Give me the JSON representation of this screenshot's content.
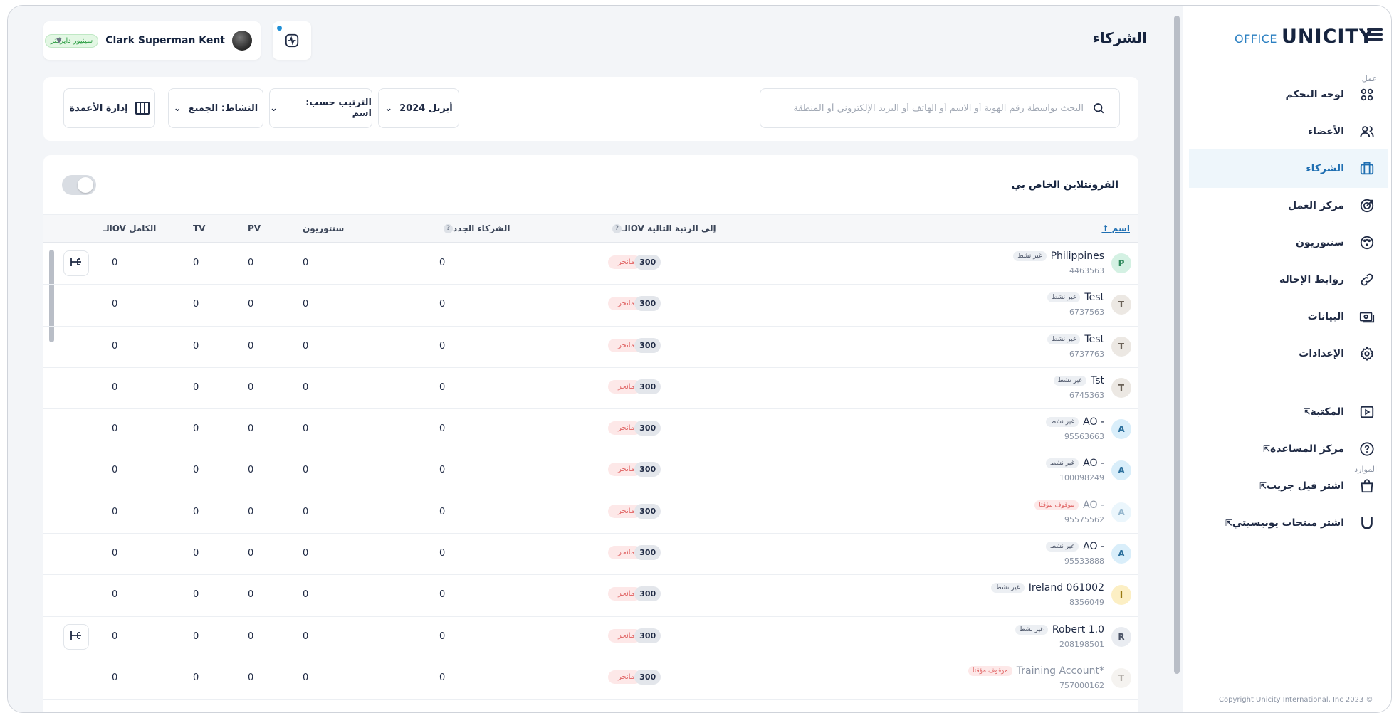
{
  "brand": {
    "office": "OFFICE",
    "unicity": "UNICITY"
  },
  "sidebar": {
    "section_work": "عمل",
    "section_resources": "الموارد",
    "items": [
      {
        "label": "لوحة التحكم",
        "icon": "dashboard-icon",
        "active": false,
        "external": false
      },
      {
        "label": "الأعضاء",
        "icon": "members-icon",
        "active": false,
        "external": false
      },
      {
        "label": "الشركاء",
        "icon": "partners-icon",
        "active": true,
        "external": false
      },
      {
        "label": "مركز العمل",
        "icon": "target-icon",
        "active": false,
        "external": false
      },
      {
        "label": "سنتوريون",
        "icon": "centurion-icon",
        "active": false,
        "external": false
      },
      {
        "label": "روابط الإحالة",
        "icon": "link-icon",
        "active": false,
        "external": false
      },
      {
        "label": "البيانات",
        "icon": "money-icon",
        "active": false,
        "external": false
      },
      {
        "label": "الإعدادات",
        "icon": "gear-icon",
        "active": false,
        "external": false
      }
    ],
    "resources": [
      {
        "label": "المكتبة",
        "icon": "play-icon",
        "external": true
      },
      {
        "label": "مركز المساعدة",
        "icon": "help-icon",
        "external": true
      },
      {
        "label": "اشتر فيل جريت",
        "icon": "bag-icon",
        "external": true
      },
      {
        "label": "اشتر منتجات يونيسيتي",
        "icon": "unicity-u-icon",
        "external": true
      }
    ],
    "external_glyph": "⇱",
    "copyright": "Copyright Unicity International, Inc 2023 ©"
  },
  "header": {
    "title": "الشركاء",
    "user": {
      "name": "Clark Superman Kent",
      "rank": "سينيور دايركتر"
    }
  },
  "filters": {
    "search_placeholder": "البحث بواسطة رقم الهوية أو الاسم أو الهاتف أو البريد الإلكتروني أو المنطقة",
    "month": "أبريل 2024",
    "sort": "الترتيب حسب: اسم",
    "activity": "النشاط: الجميع",
    "columns": "إدارة الأعمدة"
  },
  "frontline": {
    "title": "الفرونتلاين الخاص بي",
    "columns": {
      "name": "اسم",
      "ov_next": "الـOV إلى الرتبة التالية",
      "new_partners": "الشركاء الجدد",
      "centurion": "سنتوريون",
      "pv": "PV",
      "tv": "TV",
      "full_ov": "الـOV الكامل"
    },
    "help_glyph": "?",
    "rows": [
      {
        "letter": "P",
        "letter_color": "#d4f1e3",
        "letter_text": "#2f8a5c",
        "name": "Philippines",
        "id": "4463563",
        "status": "غير نشط",
        "paused": false,
        "dim": false,
        "ov_next": "300",
        "next_rank": "مانجر",
        "new_partners": "0",
        "centurion": "0",
        "pv": "0",
        "tv": "0",
        "full_ov": "0",
        "tree": true
      },
      {
        "letter": "T",
        "letter_color": "#ece8e3",
        "letter_text": "#6b6258",
        "name": "Test",
        "id": "6737563",
        "status": "غير نشط",
        "paused": false,
        "dim": false,
        "ov_next": "300",
        "next_rank": "مانجر",
        "new_partners": "0",
        "centurion": "0",
        "pv": "0",
        "tv": "0",
        "full_ov": "0",
        "tree": false
      },
      {
        "letter": "T",
        "letter_color": "#ece8e3",
        "letter_text": "#6b6258",
        "name": "Test",
        "id": "6737763",
        "status": "غير نشط",
        "paused": false,
        "dim": false,
        "ov_next": "300",
        "next_rank": "مانجر",
        "new_partners": "0",
        "centurion": "0",
        "pv": "0",
        "tv": "0",
        "full_ov": "0",
        "tree": false
      },
      {
        "letter": "T",
        "letter_color": "#ece8e3",
        "letter_text": "#6b6258",
        "name": "Tst",
        "id": "6745363",
        "status": "غير نشط",
        "paused": false,
        "dim": false,
        "ov_next": "300",
        "next_rank": "مانجر",
        "new_partners": "0",
        "centurion": "0",
        "pv": "0",
        "tv": "0",
        "full_ov": "0",
        "tree": false
      },
      {
        "letter": "A",
        "letter_color": "#d9eefa",
        "letter_text": "#2b6f9c",
        "name": "AO -",
        "id": "95563663",
        "status": "غير نشط",
        "paused": false,
        "dim": false,
        "ov_next": "300",
        "next_rank": "مانجر",
        "new_partners": "0",
        "centurion": "0",
        "pv": "0",
        "tv": "0",
        "full_ov": "0",
        "tree": false
      },
      {
        "letter": "A",
        "letter_color": "#d9eefa",
        "letter_text": "#2b6f9c",
        "name": "AO -",
        "id": "100098249",
        "status": "غير نشط",
        "paused": false,
        "dim": false,
        "ov_next": "300",
        "next_rank": "مانجر",
        "new_partners": "0",
        "centurion": "0",
        "pv": "0",
        "tv": "0",
        "full_ov": "0",
        "tree": false
      },
      {
        "letter": "A",
        "letter_color": "#d9eefa",
        "letter_text": "#2b6f9c",
        "name": "AO -",
        "id": "95575562",
        "status": "موقوف مؤقتا",
        "paused": true,
        "dim": true,
        "ov_next": "300",
        "next_rank": "مانجر",
        "new_partners": "0",
        "centurion": "0",
        "pv": "0",
        "tv": "0",
        "full_ov": "0",
        "tree": false
      },
      {
        "letter": "A",
        "letter_color": "#d9eefa",
        "letter_text": "#2b6f9c",
        "name": "AO -",
        "id": "95533888",
        "status": "غير نشط",
        "paused": false,
        "dim": false,
        "ov_next": "300",
        "next_rank": "مانجر",
        "new_partners": "0",
        "centurion": "0",
        "pv": "0",
        "tv": "0",
        "full_ov": "0",
        "tree": false
      },
      {
        "letter": "I",
        "letter_color": "#fcefc4",
        "letter_text": "#9a7a12",
        "name": "Ireland 061002",
        "id": "8356049",
        "status": "غير نشط",
        "paused": false,
        "dim": false,
        "ov_next": "300",
        "next_rank": "مانجر",
        "new_partners": "0",
        "centurion": "0",
        "pv": "0",
        "tv": "0",
        "full_ov": "0",
        "tree": false
      },
      {
        "letter": "R",
        "letter_color": "#e9ecf1",
        "letter_text": "#4a5366",
        "name": "Robert 1.0",
        "id": "208198501",
        "status": "غير نشط",
        "paused": false,
        "dim": false,
        "ov_next": "300",
        "next_rank": "مانجر",
        "new_partners": "0",
        "centurion": "0",
        "pv": "0",
        "tv": "0",
        "full_ov": "0",
        "tree": true
      },
      {
        "letter": "T",
        "letter_color": "#ece8e3",
        "letter_text": "#6b6258",
        "name": "Training Account*",
        "id": "757000162",
        "status": "موقوف مؤقتا",
        "paused": true,
        "dim": true,
        "ov_next": "300",
        "next_rank": "مانجر",
        "new_partners": "0",
        "centurion": "0",
        "pv": "0",
        "tv": "0",
        "full_ov": "0",
        "tree": false
      }
    ]
  }
}
